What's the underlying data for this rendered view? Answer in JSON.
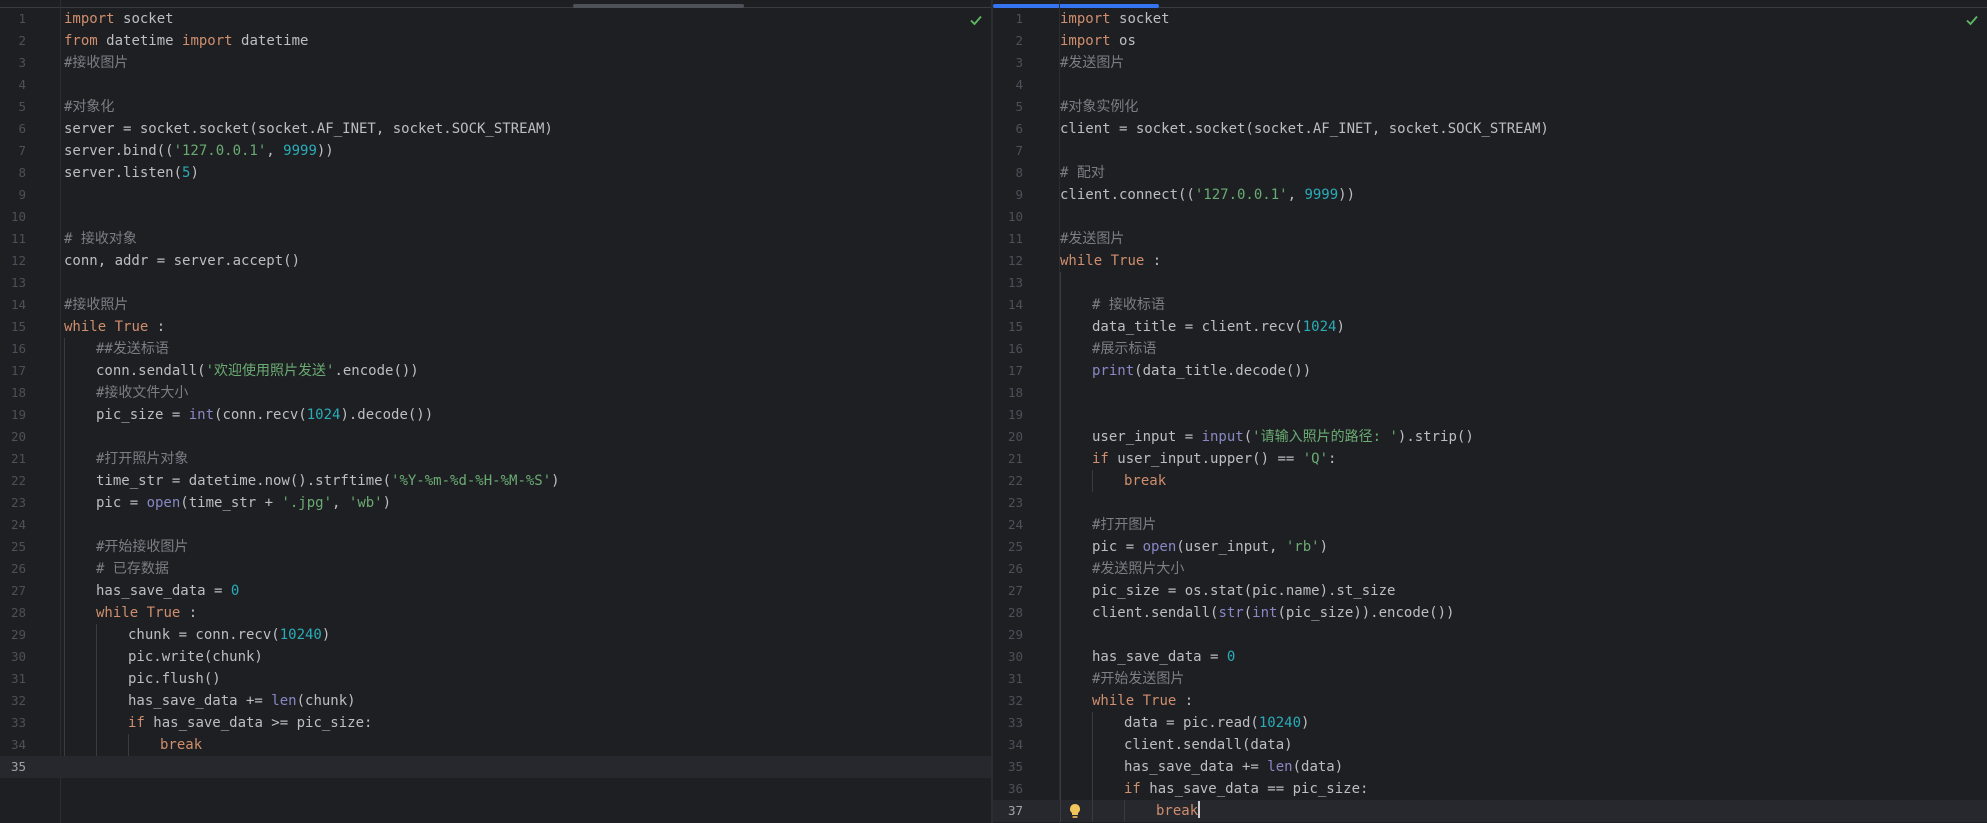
{
  "left_editor": {
    "current_line": 35,
    "lines": [
      {
        "n": "1",
        "indent": 0,
        "tokens": [
          [
            "kw",
            "import"
          ],
          [
            "",
            "socket"
          ]
        ]
      },
      {
        "n": "2",
        "indent": 0,
        "tokens": [
          [
            "kw",
            "from"
          ],
          [
            "",
            "datetime "
          ],
          [
            "kw",
            "import"
          ],
          [
            "",
            "datetime"
          ]
        ]
      },
      {
        "n": "3",
        "indent": 0,
        "tokens": [
          [
            "cmt",
            "#接收图片"
          ]
        ]
      },
      {
        "n": "4",
        "indent": 0,
        "tokens": []
      },
      {
        "n": "5",
        "indent": 0,
        "tokens": [
          [
            "cmt",
            "#对象化"
          ]
        ]
      },
      {
        "n": "6",
        "indent": 0,
        "tokens": [
          [
            "",
            "server = socket.socket(socket.AF_INET, socket.SOCK_STREAM)"
          ]
        ]
      },
      {
        "n": "7",
        "indent": 0,
        "tokens": [
          [
            "",
            "server.bind(("
          ],
          [
            "str",
            "'127.0.0.1'"
          ],
          [
            "",
            ", "
          ],
          [
            "num",
            "9999"
          ],
          [
            "",
            "))"
          ]
        ]
      },
      {
        "n": "8",
        "indent": 0,
        "tokens": [
          [
            "",
            "server.listen("
          ],
          [
            "num",
            "5"
          ],
          [
            "",
            ")"
          ]
        ]
      },
      {
        "n": "9",
        "indent": 0,
        "tokens": []
      },
      {
        "n": "10",
        "indent": 0,
        "tokens": []
      },
      {
        "n": "11",
        "indent": 0,
        "tokens": [
          [
            "cmt",
            "# 接收对象"
          ]
        ]
      },
      {
        "n": "12",
        "indent": 0,
        "tokens": [
          [
            "",
            "conn, addr = server.accept()"
          ]
        ]
      },
      {
        "n": "13",
        "indent": 0,
        "tokens": []
      },
      {
        "n": "14",
        "indent": 0,
        "tokens": [
          [
            "cmt",
            "#接收照片"
          ]
        ]
      },
      {
        "n": "15",
        "indent": 0,
        "tokens": [
          [
            "kw",
            "while"
          ],
          [
            "kw",
            "True"
          ],
          [
            "",
            ":"
          ]
        ]
      },
      {
        "n": "16",
        "indent": 1,
        "tokens": [
          [
            "cmt",
            "##发送标语"
          ]
        ]
      },
      {
        "n": "17",
        "indent": 1,
        "tokens": [
          [
            "",
            "conn.sendall("
          ],
          [
            "str",
            "'欢迎使用照片发送'"
          ],
          [
            "",
            ".encode())"
          ]
        ]
      },
      {
        "n": "18",
        "indent": 1,
        "tokens": [
          [
            "cmt",
            "#接收文件大小"
          ]
        ]
      },
      {
        "n": "19",
        "indent": 1,
        "tokens": [
          [
            "",
            "pic_size = "
          ],
          [
            "bi",
            "int"
          ],
          [
            "",
            "(conn.recv("
          ],
          [
            "num",
            "1024"
          ],
          [
            "",
            ").decode())"
          ]
        ]
      },
      {
        "n": "20",
        "indent": 1,
        "tokens": []
      },
      {
        "n": "21",
        "indent": 1,
        "tokens": [
          [
            "cmt",
            "#打开照片对象"
          ]
        ]
      },
      {
        "n": "22",
        "indent": 1,
        "tokens": [
          [
            "",
            "time_str = datetime.now().strftime("
          ],
          [
            "str",
            "'%Y-%m-%d-%H-%M-%S'"
          ],
          [
            "",
            ")"
          ]
        ]
      },
      {
        "n": "23",
        "indent": 1,
        "tokens": [
          [
            "",
            "pic = "
          ],
          [
            "bi",
            "open"
          ],
          [
            "",
            "(time_str + "
          ],
          [
            "str",
            "'.jpg'"
          ],
          [
            "",
            ", "
          ],
          [
            "str",
            "'wb'"
          ],
          [
            "",
            ")"
          ]
        ]
      },
      {
        "n": "24",
        "indent": 1,
        "tokens": []
      },
      {
        "n": "25",
        "indent": 1,
        "tokens": [
          [
            "cmt",
            "#开始接收图片"
          ]
        ]
      },
      {
        "n": "26",
        "indent": 1,
        "tokens": [
          [
            "cmt",
            "# 已存数据"
          ]
        ]
      },
      {
        "n": "27",
        "indent": 1,
        "tokens": [
          [
            "",
            "has_save_data = "
          ],
          [
            "num",
            "0"
          ]
        ]
      },
      {
        "n": "28",
        "indent": 1,
        "tokens": [
          [
            "kw",
            "while"
          ],
          [
            "kw",
            "True"
          ],
          [
            "",
            ":"
          ]
        ]
      },
      {
        "n": "29",
        "indent": 2,
        "tokens": [
          [
            "",
            "chunk = conn.recv("
          ],
          [
            "num",
            "10240"
          ],
          [
            "",
            ")"
          ]
        ]
      },
      {
        "n": "30",
        "indent": 2,
        "tokens": [
          [
            "",
            "pic.write(chunk)"
          ]
        ]
      },
      {
        "n": "31",
        "indent": 2,
        "tokens": [
          [
            "",
            "pic.flush()"
          ]
        ]
      },
      {
        "n": "32",
        "indent": 2,
        "tokens": [
          [
            "",
            "has_save_data += "
          ],
          [
            "bi",
            "len"
          ],
          [
            "",
            "(chunk)"
          ]
        ]
      },
      {
        "n": "33",
        "indent": 2,
        "tokens": [
          [
            "kw",
            "if"
          ],
          [
            "",
            "has_save_data >= pic_size:"
          ]
        ]
      },
      {
        "n": "34",
        "indent": 3,
        "tokens": [
          [
            "kw",
            "break"
          ]
        ]
      },
      {
        "n": "35",
        "indent": 0,
        "tokens": []
      }
    ]
  },
  "right_editor": {
    "current_line": 37,
    "lines": [
      {
        "n": "1",
        "indent": 0,
        "tokens": [
          [
            "kw",
            "import"
          ],
          [
            "",
            "socket"
          ]
        ]
      },
      {
        "n": "2",
        "indent": 0,
        "tokens": [
          [
            "kw",
            "import"
          ],
          [
            "",
            "os"
          ]
        ]
      },
      {
        "n": "3",
        "indent": 0,
        "tokens": [
          [
            "cmt",
            "#发送图片"
          ]
        ]
      },
      {
        "n": "4",
        "indent": 0,
        "tokens": []
      },
      {
        "n": "5",
        "indent": 0,
        "tokens": [
          [
            "cmt",
            "#对象实例化"
          ]
        ]
      },
      {
        "n": "6",
        "indent": 0,
        "tokens": [
          [
            "",
            "client = socket.socket(socket.AF_INET, socket.SOCK_STREAM)"
          ]
        ]
      },
      {
        "n": "7",
        "indent": 0,
        "tokens": []
      },
      {
        "n": "8",
        "indent": 0,
        "tokens": [
          [
            "cmt",
            "# 配对"
          ]
        ]
      },
      {
        "n": "9",
        "indent": 0,
        "tokens": [
          [
            "",
            "client.connect(("
          ],
          [
            "str",
            "'127.0.0.1'"
          ],
          [
            "",
            ", "
          ],
          [
            "num",
            "9999"
          ],
          [
            "",
            "))"
          ]
        ]
      },
      {
        "n": "10",
        "indent": 0,
        "tokens": []
      },
      {
        "n": "11",
        "indent": 0,
        "tokens": [
          [
            "cmt",
            "#发送图片"
          ]
        ]
      },
      {
        "n": "12",
        "indent": 0,
        "tokens": [
          [
            "kw",
            "while"
          ],
          [
            "kw",
            "True"
          ],
          [
            "",
            ":"
          ]
        ]
      },
      {
        "n": "13",
        "indent": 1,
        "tokens": []
      },
      {
        "n": "14",
        "indent": 1,
        "tokens": [
          [
            "cmt",
            "# 接收标语"
          ]
        ]
      },
      {
        "n": "15",
        "indent": 1,
        "tokens": [
          [
            "",
            "data_title = client.recv("
          ],
          [
            "num",
            "1024"
          ],
          [
            "",
            ")"
          ]
        ]
      },
      {
        "n": "16",
        "indent": 1,
        "tokens": [
          [
            "cmt",
            "#展示标语"
          ]
        ]
      },
      {
        "n": "17",
        "indent": 1,
        "tokens": [
          [
            "bi",
            "print"
          ],
          [
            "",
            "(data_title.decode())"
          ]
        ]
      },
      {
        "n": "18",
        "indent": 1,
        "tokens": []
      },
      {
        "n": "19",
        "indent": 1,
        "tokens": []
      },
      {
        "n": "20",
        "indent": 1,
        "tokens": [
          [
            "",
            "user_input = "
          ],
          [
            "bi",
            "input"
          ],
          [
            "",
            "("
          ],
          [
            "str",
            "'请输入照片的路径: '"
          ],
          [
            "",
            ").strip()"
          ]
        ]
      },
      {
        "n": "21",
        "indent": 1,
        "tokens": [
          [
            "kw",
            "if"
          ],
          [
            "",
            "user_input.upper() == "
          ],
          [
            "str",
            "'Q'"
          ],
          [
            "",
            ":"
          ]
        ]
      },
      {
        "n": "22",
        "indent": 2,
        "tokens": [
          [
            "kw",
            "break"
          ]
        ]
      },
      {
        "n": "23",
        "indent": 1,
        "tokens": []
      },
      {
        "n": "24",
        "indent": 1,
        "tokens": [
          [
            "cmt",
            "#打开图片"
          ]
        ]
      },
      {
        "n": "25",
        "indent": 1,
        "tokens": [
          [
            "",
            "pic = "
          ],
          [
            "bi",
            "open"
          ],
          [
            "",
            "(user_input, "
          ],
          [
            "str",
            "'rb'"
          ],
          [
            "",
            ")"
          ]
        ]
      },
      {
        "n": "26",
        "indent": 1,
        "tokens": [
          [
            "cmt",
            "#发送照片大小"
          ]
        ]
      },
      {
        "n": "27",
        "indent": 1,
        "tokens": [
          [
            "",
            "pic_size = os.stat(pic.name).st_size"
          ]
        ]
      },
      {
        "n": "28",
        "indent": 1,
        "tokens": [
          [
            "",
            "client.sendall("
          ],
          [
            "bi",
            "str"
          ],
          [
            "",
            "("
          ],
          [
            "bi",
            "int"
          ],
          [
            "",
            "(pic_size)).encode())"
          ]
        ]
      },
      {
        "n": "29",
        "indent": 1,
        "tokens": []
      },
      {
        "n": "30",
        "indent": 1,
        "tokens": [
          [
            "",
            "has_save_data = "
          ],
          [
            "num",
            "0"
          ]
        ]
      },
      {
        "n": "31",
        "indent": 1,
        "tokens": [
          [
            "cmt",
            "#开始发送图片"
          ]
        ]
      },
      {
        "n": "32",
        "indent": 1,
        "tokens": [
          [
            "kw",
            "while"
          ],
          [
            "kw",
            "True"
          ],
          [
            "",
            ":"
          ]
        ]
      },
      {
        "n": "33",
        "indent": 2,
        "tokens": [
          [
            "",
            "data = pic.read("
          ],
          [
            "num",
            "10240"
          ],
          [
            "",
            ")"
          ]
        ]
      },
      {
        "n": "34",
        "indent": 2,
        "tokens": [
          [
            "",
            "client.sendall(data)"
          ]
        ]
      },
      {
        "n": "35",
        "indent": 2,
        "tokens": [
          [
            "",
            "has_save_data += "
          ],
          [
            "bi",
            "len"
          ],
          [
            "",
            "(data)"
          ]
        ]
      },
      {
        "n": "36",
        "indent": 2,
        "tokens": [
          [
            "kw",
            "if"
          ],
          [
            "",
            "has_save_data == pic_size:"
          ]
        ]
      },
      {
        "n": "37",
        "indent": 3,
        "tokens": [
          [
            "kw",
            "break"
          ]
        ]
      }
    ]
  },
  "colors": {
    "background": "#1e1f22",
    "keyword": "#cf8e6d",
    "string": "#6aab73",
    "number": "#2aacb8",
    "comment": "#7a7e85",
    "builtin": "#8888c6",
    "check": "#5fb865",
    "active_tab_accent": "#3574f0",
    "bulb": "#f2c55c"
  },
  "icons": {
    "inspection_ok": "check-icon",
    "intention_action": "lightbulb-icon"
  }
}
